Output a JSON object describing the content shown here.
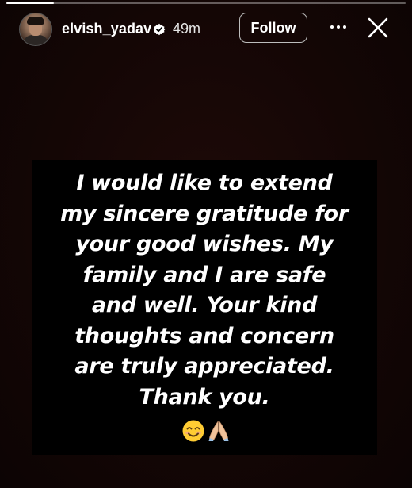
{
  "story": {
    "progress": 0.12,
    "header": {
      "username": "elvish_yadav",
      "time_ago": "49m",
      "follow_label": "Follow",
      "icons": {
        "avatar": "profile-avatar",
        "verified": "verified-badge-icon",
        "more": "more-options-icon",
        "close": "close-icon"
      }
    },
    "message": {
      "text": "I would like to extend\nmy sincere gratitude for\nyour good wishes. My\nfamily and I are safe\nand well. Your kind\nthoughts and concern\nare truly appreciated.\nThank you.",
      "emojis": [
        "smiling-face-emoji",
        "folded-hands-emoji"
      ]
    }
  },
  "colors": {
    "background": "#140605",
    "text_box": "#000000",
    "text": "#ffffff",
    "button_border": "#bdbdbd"
  }
}
